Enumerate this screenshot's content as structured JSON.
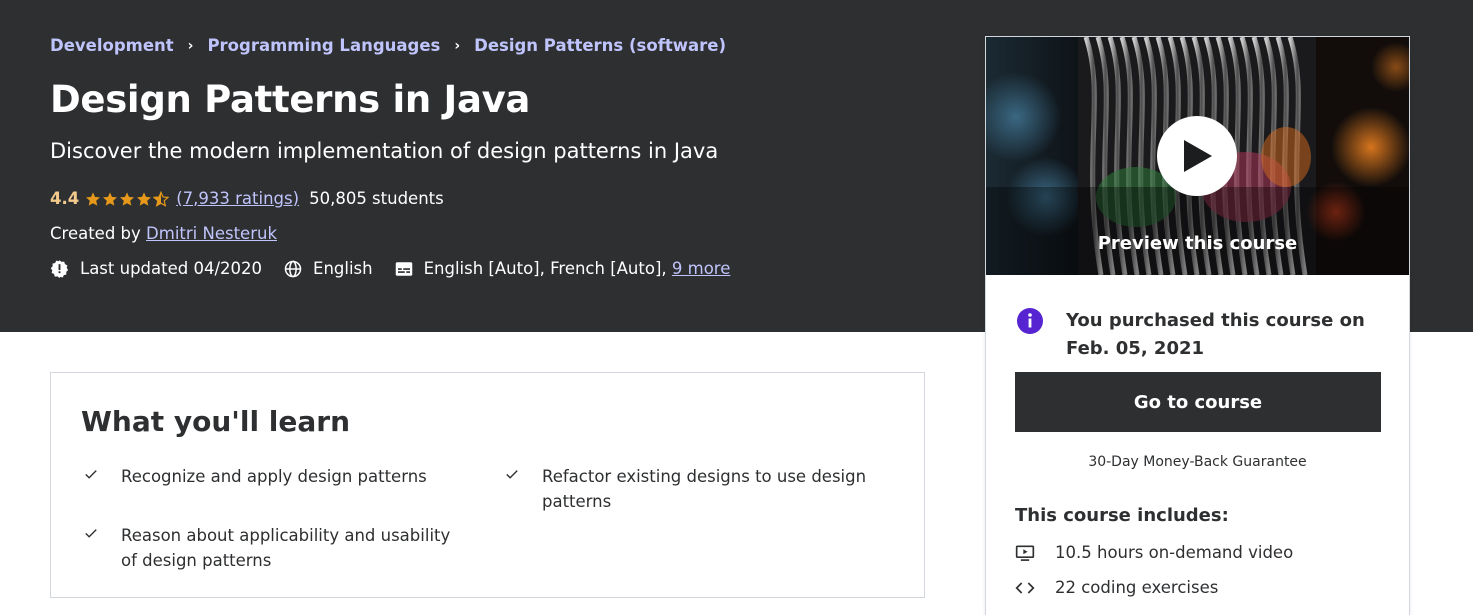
{
  "breadcrumb": {
    "items": [
      "Development",
      "Programming Languages",
      "Design Patterns (software)"
    ],
    "separator": "›"
  },
  "course": {
    "title": "Design Patterns in Java",
    "subtitle": "Discover the modern implementation of design patterns in Java",
    "rating": "4.4",
    "rating_value": 4.4,
    "ratings_count": "(7,933 ratings)",
    "students": "50,805 students",
    "created_by_prefix": "Created by",
    "instructor": "Dmitri Nesteruk",
    "last_updated": "Last updated 04/2020",
    "language": "English",
    "captions": "English [Auto], French [Auto],",
    "captions_more": "9 more"
  },
  "learn": {
    "title": "What you'll learn",
    "items": [
      "Recognize and apply design patterns",
      "Refactor existing designs to use design patterns",
      "Reason about applicability and usability of design patterns"
    ]
  },
  "sidebar": {
    "preview_label": "Preview this course",
    "purchased_text": "You purchased this course on Feb. 05, 2021",
    "go_button": "Go to course",
    "guarantee": "30-Day Money-Back Guarantee",
    "includes_title": "This course includes:",
    "includes": [
      {
        "icon": "video-icon",
        "text": "10.5 hours on-demand video"
      },
      {
        "icon": "code-icon",
        "text": "22 coding exercises"
      }
    ]
  },
  "colors": {
    "hero_bg": "#2d2f31",
    "link": "#c0c4fc",
    "rating": "#f3ca8c",
    "star": "#e59819",
    "info_purple": "#5624d0",
    "button_bg": "#2d2f31"
  },
  "icons": [
    "chevron-right-icon",
    "star-icon",
    "half-star-icon",
    "alert-icon",
    "globe-icon",
    "captions-icon",
    "check-icon",
    "play-icon",
    "info-icon",
    "video-icon",
    "code-icon"
  ]
}
